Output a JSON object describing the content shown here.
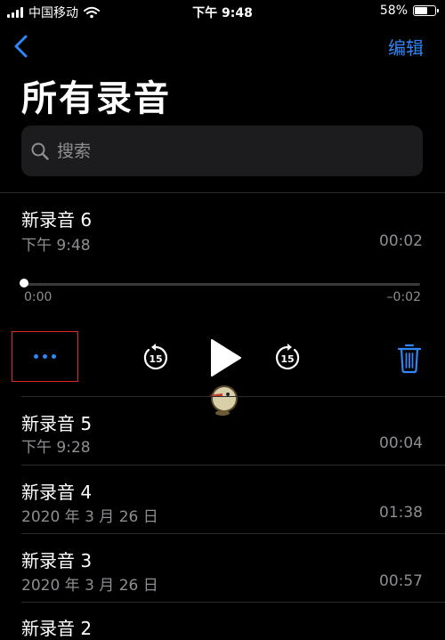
{
  "status_bar": {
    "carrier": "中国移动",
    "time": "下午 9:48",
    "battery": "58%",
    "battery_level": 0.58
  },
  "nav": {
    "edit_label": "编辑"
  },
  "page": {
    "title": "所有录音"
  },
  "search": {
    "placeholder": "搜索"
  },
  "recordings": [
    {
      "title": "新录音 6",
      "date": "下午 9:48",
      "duration": "00:02"
    },
    {
      "title": "新录音 5",
      "date": "下午 9:28",
      "duration": "00:04"
    },
    {
      "title": "新录音 4",
      "date": "2020 年 3 月 26 日",
      "duration": "01:38"
    },
    {
      "title": "新录音 3",
      "date": "2020 年 3 月 26 日",
      "duration": "00:57"
    },
    {
      "title": "新录音 2"
    }
  ],
  "player": {
    "elapsed": "0:00",
    "remaining": "–0:02",
    "skip_back_seconds": "15",
    "skip_forward_seconds": "15",
    "progress": 0
  },
  "colors": {
    "accent": "#2f86f6",
    "highlight_box": "#e0262b",
    "secondary_text": "#8e8e93"
  },
  "icons": [
    "signal-icon",
    "wifi-icon",
    "battery-icon",
    "back-chevron-icon",
    "search-icon",
    "more-icon",
    "skip-back-15-icon",
    "play-icon",
    "skip-forward-15-icon",
    "trash-icon"
  ]
}
